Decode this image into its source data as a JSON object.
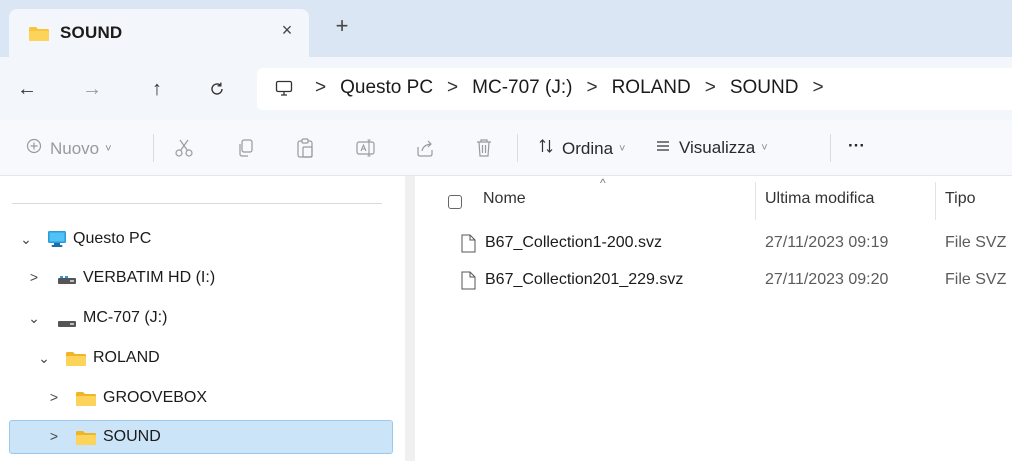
{
  "tab": {
    "title": "SOUND",
    "close": "×",
    "new": "+"
  },
  "nav": {
    "back": "←",
    "forward": "→",
    "up": "↑",
    "refresh": "C"
  },
  "address": {
    "crumbs": [
      "Questo PC",
      "MC-707 (J:)",
      "ROLAND",
      "SOUND"
    ],
    "separator": ">"
  },
  "command_bar": {
    "new_label": "Nuovo",
    "sort_label": "Ordina",
    "view_label": "Visualizza",
    "more_label": "···",
    "icons": [
      "plus-circle-icon",
      "cut-icon",
      "copy-icon",
      "paste-icon",
      "rename-icon",
      "share-icon",
      "delete-icon",
      "sort-icon",
      "view-icon"
    ]
  },
  "sidebar": {
    "items": [
      {
        "label": "Questo PC",
        "chevron": "⌄",
        "icon": "computer-icon"
      },
      {
        "label": "VERBATIM HD (I:)",
        "chevron": ">",
        "icon": "drive-icon"
      },
      {
        "label": "MC-707 (J:)",
        "chevron": "⌄",
        "icon": "drive-icon"
      },
      {
        "label": "ROLAND",
        "chevron": "⌄",
        "icon": "folder-icon"
      },
      {
        "label": "GROOVEBOX",
        "chevron": ">",
        "icon": "folder-icon"
      },
      {
        "label": "SOUND",
        "chevron": ">",
        "icon": "folder-icon"
      }
    ],
    "selected": "SOUND"
  },
  "file_list": {
    "columns": {
      "name": "Nome",
      "modified": "Ultima modifica",
      "type": "Tipo"
    },
    "sort_indicator": "^",
    "rows": [
      {
        "name": "B67_Collection1-200.svz",
        "modified": "27/11/2023 09:19",
        "type": "File SVZ"
      },
      {
        "name": "B67_Collection201_229.svz",
        "modified": "27/11/2023 09:20",
        "type": "File SVZ"
      }
    ]
  },
  "colors": {
    "tab_strip": "#dbe6f4",
    "toolbar": "#f3f6fb",
    "selection": "#cce4f7",
    "folder": "#f8c43a",
    "accent": "#0078d4"
  }
}
